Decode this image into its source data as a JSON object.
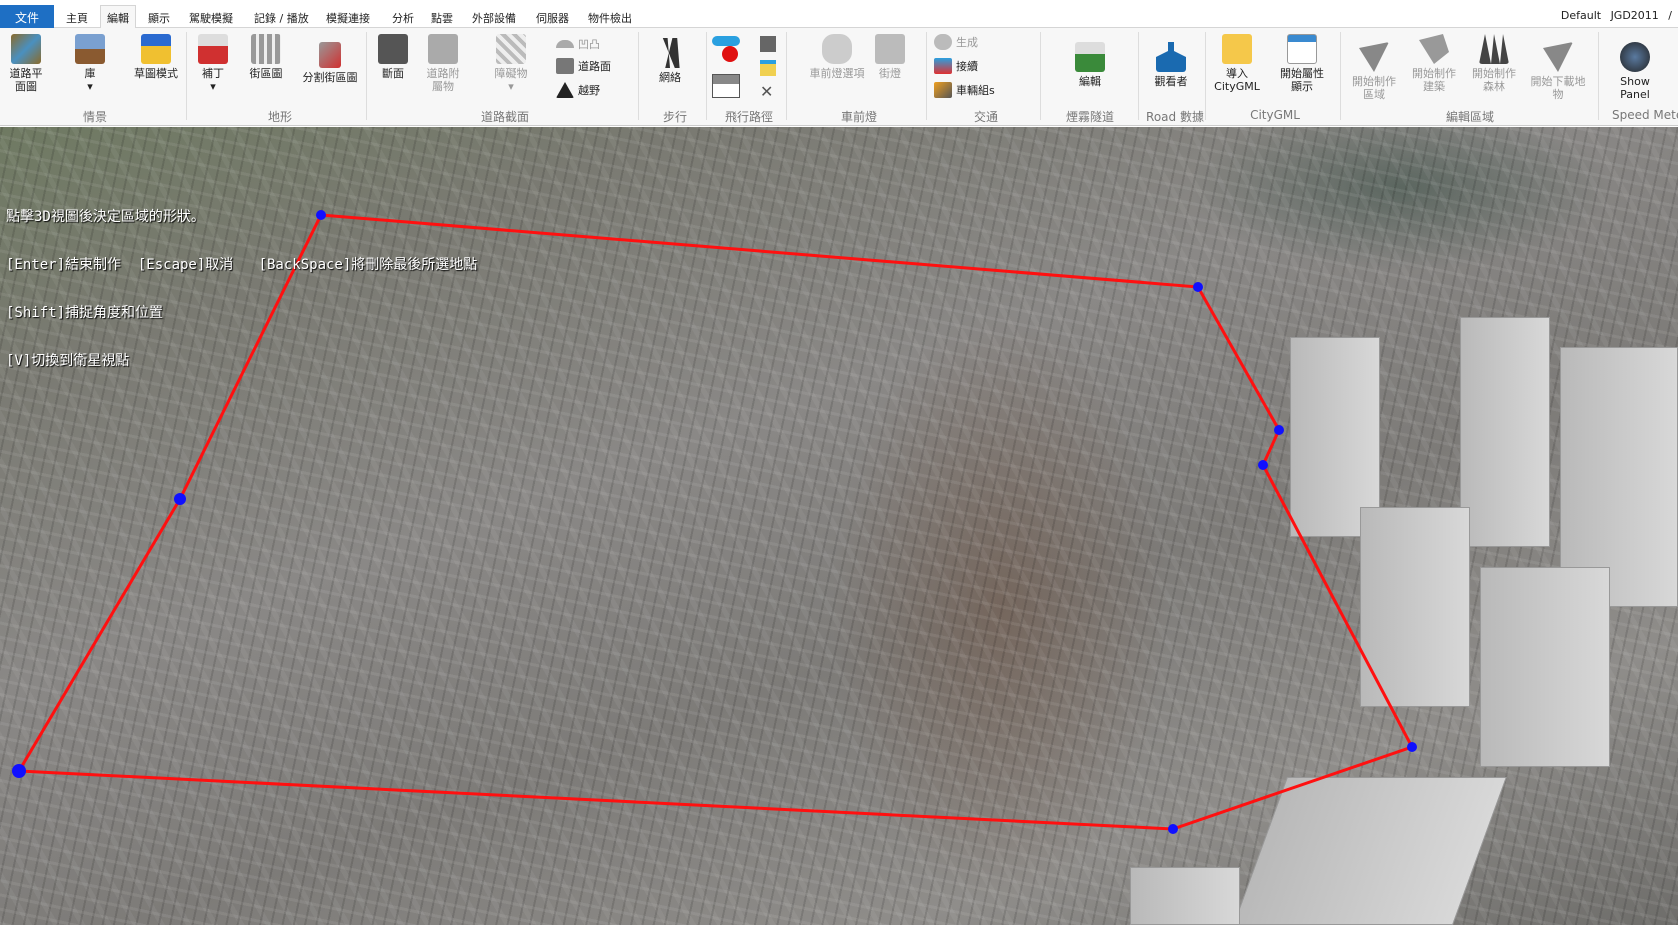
{
  "tabs": {
    "file": "文件",
    "items": [
      "主頁",
      "編輯",
      "顯示",
      "駕駛模擬",
      "記錄 / 播放",
      "模擬連接",
      "分析",
      "點雲",
      "外部設備",
      "伺服器",
      "物件檢出"
    ],
    "active": "編輯"
  },
  "status_right": "Default  JGD2011 /",
  "ribbon": {
    "buttons": {
      "road_plan": "道路平\n面圖",
      "library": "庫",
      "sketch": "草圖模式",
      "patch": "補丁",
      "block": "街區圖",
      "split_block": "分割街區圖",
      "section": "斷面",
      "road_attach": "道路附\n屬物",
      "obstacle": "障礙物",
      "bump": "凹凸",
      "road_surface": "道路面",
      "offroad": "越野",
      "network": "網絡",
      "headlight": "車前燈選項",
      "streetlight": "街燈",
      "generate": "生成",
      "connect": "接續",
      "vehicle_group": "車輛組s",
      "fog_edit": "編輯",
      "viewer": "觀看者",
      "import_citygml": "導入\nCityGML",
      "attr_display": "開始屬性\n顯示",
      "make_area": "開始制作\n區域",
      "make_building": "開始制作\n建築",
      "make_forest": "開始制作\n森林",
      "download_features": "開始下載地\n物",
      "show_panel": "Show Panel"
    },
    "groups": [
      "情景",
      "地形",
      "道路截面",
      "步行",
      "飛行路徑",
      "車前燈",
      "交通",
      "煙霧隧道",
      "Road 數據",
      "CityGML",
      "編輯區域",
      "Speed Mete"
    ]
  },
  "overlay": {
    "lines": [
      "點擊3D視圖後決定區域的形狀。",
      "[Enter]結束制作  [Escape]取消   [BackSpace]將刪除最後所選地點",
      "[Shift]捕捉角度和位置",
      "[V]切換到衛星視點"
    ]
  },
  "colors": {
    "accent": "#1e6fc4",
    "polygon": "#ff1010",
    "vertex": "#1010ff"
  }
}
